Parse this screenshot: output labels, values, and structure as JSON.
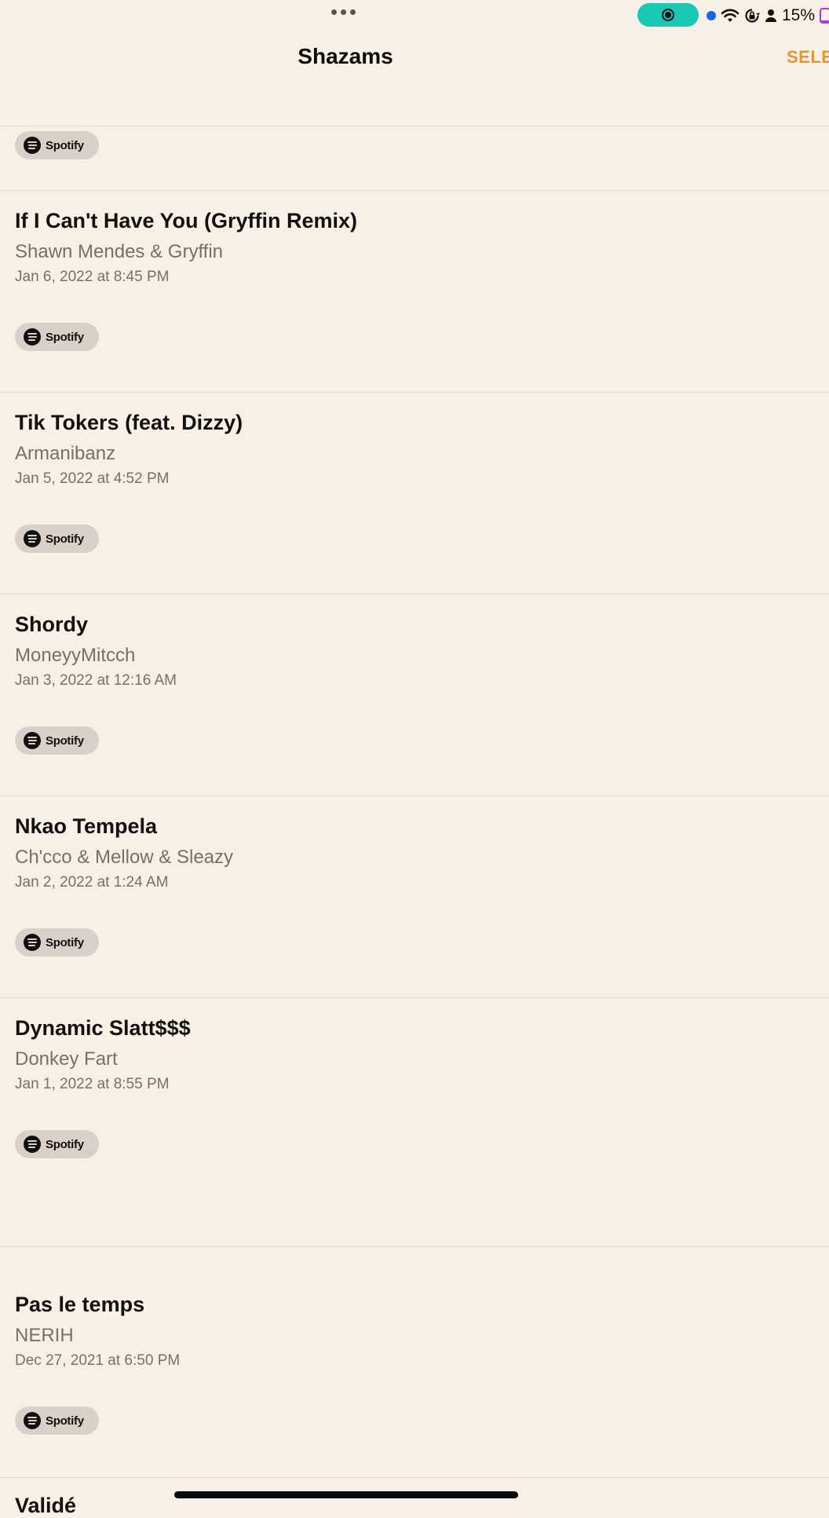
{
  "status_bar": {
    "battery_text": "15%",
    "battery_level": 0.15,
    "icons": [
      "more-dots-icon",
      "screen-record-icon",
      "location-dot-icon",
      "wifi-icon",
      "orientation-lock-icon",
      "person-icon",
      "battery-icon"
    ]
  },
  "header": {
    "title": "Shazams",
    "select_label": "SELE"
  },
  "spotify_label": "Spotify",
  "tracks": [
    {
      "title": "If I Can't Have You (Gryffin Remix)",
      "artist": "Shawn Mendes & Gryffin",
      "date": "Jan 6, 2022 at 8:45 PM"
    },
    {
      "title": "Tik Tokers (feat. Dizzy)",
      "artist": "Armanibanz",
      "date": "Jan 5, 2022 at 4:52 PM"
    },
    {
      "title": "Shordy",
      "artist": "MoneyyMitcch",
      "date": "Jan 3, 2022 at 12:16 AM"
    },
    {
      "title": "Nkao Tempela",
      "artist": "Ch'cco & Mellow & Sleazy",
      "date": "Jan 2, 2022 at 1:24 AM"
    },
    {
      "title": "Dynamic Slatt$$$",
      "artist": "Donkey Fart",
      "date": "Jan 1, 2022 at 8:55 PM"
    },
    {
      "title": "Pas le temps",
      "artist": "NERIH",
      "date": "Dec 27, 2021 at 6:50 PM"
    }
  ],
  "partial_next_title": "Validé",
  "colors": {
    "background": "#f8efe6",
    "accent": "#e4952c",
    "record_pill": "#19c7b5",
    "secondary_text": "#77706a"
  }
}
